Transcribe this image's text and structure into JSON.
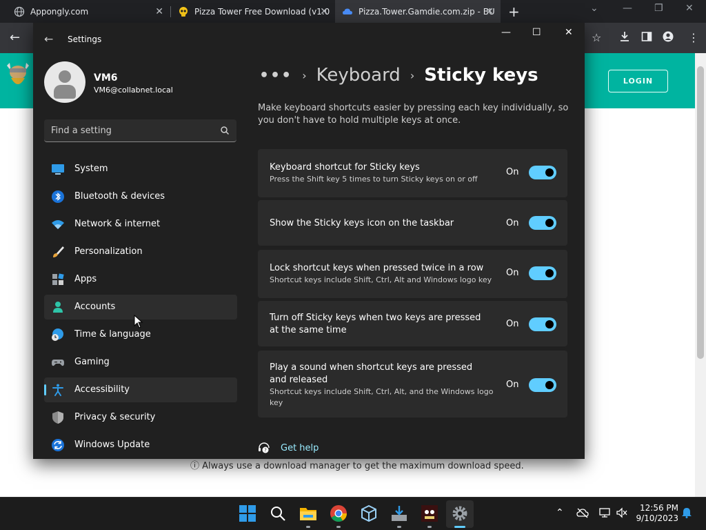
{
  "browser": {
    "tabs": [
      {
        "title": "Appongly.com",
        "close": "✕"
      },
      {
        "title": "Pizza Tower Free Download (v1.0",
        "close": "✕"
      },
      {
        "title": "Pizza.Tower.Gamdie.com.zip - BU",
        "close": "✕"
      }
    ],
    "new_tab": "+"
  },
  "webpage": {
    "login_label": "LOGIN",
    "note": "ⓘ Always use a download manager to get the maximum download speed."
  },
  "settings": {
    "window_title": "Settings",
    "user": {
      "name": "VM6",
      "email": "VM6@collabnet.local"
    },
    "search_placeholder": "Find a setting",
    "nav": [
      {
        "label": "System",
        "icon": "monitor-icon"
      },
      {
        "label": "Bluetooth & devices",
        "icon": "bluetooth-icon"
      },
      {
        "label": "Network & internet",
        "icon": "wifi-icon"
      },
      {
        "label": "Personalization",
        "icon": "paintbrush-icon"
      },
      {
        "label": "Apps",
        "icon": "apps-icon"
      },
      {
        "label": "Accounts",
        "icon": "person-icon"
      },
      {
        "label": "Time & language",
        "icon": "globe-clock-icon"
      },
      {
        "label": "Gaming",
        "icon": "gamepad-icon"
      },
      {
        "label": "Accessibility",
        "icon": "accessibility-icon"
      },
      {
        "label": "Privacy & security",
        "icon": "shield-icon"
      },
      {
        "label": "Windows Update",
        "icon": "update-icon"
      }
    ],
    "breadcrumb": {
      "dots": "•••",
      "parent": "Keyboard",
      "current": "Sticky keys"
    },
    "description": "Make keyboard shortcuts easier by pressing each key individually, so you don't have to hold multiple keys at once.",
    "options": [
      {
        "title": "Keyboard shortcut for Sticky keys",
        "subtitle": "Press the Shift key 5 times to turn Sticky keys on or off",
        "state": "On"
      },
      {
        "title": "Show the Sticky keys icon on the taskbar",
        "subtitle": "",
        "state": "On"
      },
      {
        "title": "Lock shortcut keys when pressed twice in a row",
        "subtitle": "Shortcut keys include Shift, Ctrl, Alt and Windows logo key",
        "state": "On"
      },
      {
        "title": "Turn off Sticky keys when two keys are pressed at the same time",
        "subtitle": "",
        "state": "On"
      },
      {
        "title": "Play a sound when shortcut keys are pressed and released",
        "subtitle": "Shortcut keys include Shift, Ctrl, Alt, and the Windows logo key",
        "state": "On"
      }
    ],
    "help_label": "Get help"
  },
  "taskbar": {
    "time": "12:56 PM",
    "date": "9/10/2023"
  },
  "colors": {
    "accent": "#60cdff",
    "teal_header": "#00b4a0",
    "settings_bg": "#202020",
    "card_bg": "#2b2b2b"
  }
}
